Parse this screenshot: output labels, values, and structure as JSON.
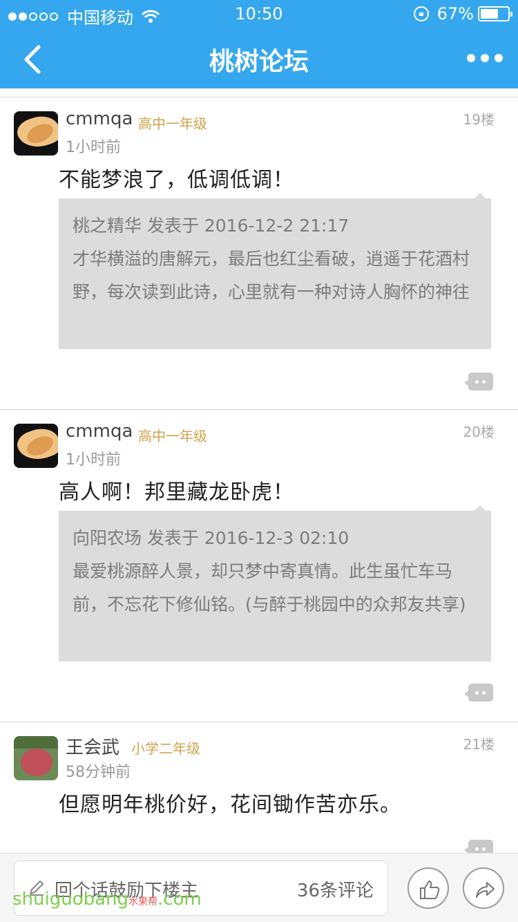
{
  "status": {
    "carrier": "中国移动",
    "time": "10:50",
    "battery": "67%",
    "battery_level": 0.67
  },
  "nav": {
    "title": "桃树论坛"
  },
  "posts": [
    {
      "username": "cmmqa",
      "grade": "高中一年级",
      "floor": "19楼",
      "time": "1小时前",
      "text": "不能梦浪了，低调低调！",
      "quote_head": "桃之精华 发表于 2016-12-2 21:17",
      "quote_body": "才华横溢的唐解元，最后也红尘看破，逍遥于花酒村野，每次读到此诗，心里就有一种对诗人胸怀的神往",
      "avatar": "hand-avatar"
    },
    {
      "username": "cmmqa",
      "grade": "高中一年级",
      "floor": "20楼",
      "time": "1小时前",
      "text": "高人啊！邦里藏龙卧虎！",
      "quote_head": "向阳农场 发表于 2016-12-3 02:10",
      "quote_body": "最爱桃源醉人景，却只梦中寄真情。此生虽忙车马前，不忘花下修仙铭。(与醉于桃园中的众邦友共享)",
      "avatar": "hand-avatar"
    },
    {
      "username": "王会武",
      "grade": "小学二年级",
      "floor": "21楼",
      "time": "58分钟前",
      "text": "但愿明年桃价好，花间锄作苦亦乐。",
      "avatar": "tree-avatar"
    }
  ],
  "bottom": {
    "placeholder": "回个话鼓励下楼主",
    "comment_count": "36条评论"
  },
  "watermark": {
    "main": "shuiguobang",
    "sub": "水果帮",
    "tld": ".com"
  },
  "colors": {
    "accent": "#35a7ee",
    "grade": "#d1a24a",
    "quote_bg": "#dcdcdc"
  }
}
